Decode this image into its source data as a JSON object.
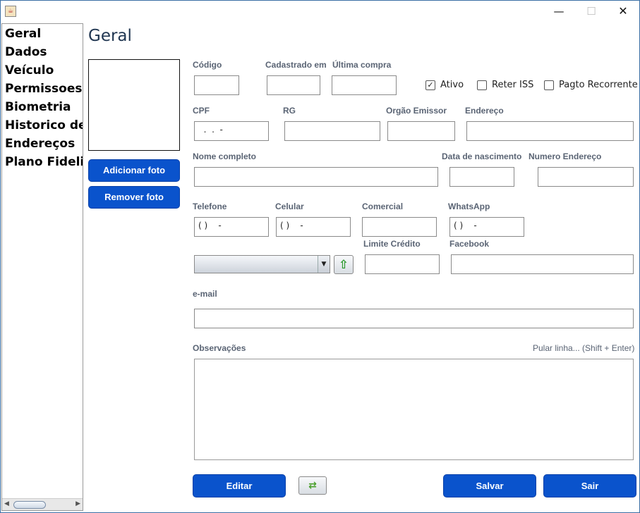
{
  "window": {
    "icon": "java-app-icon",
    "minimize": "—",
    "maximize": "☐",
    "close": "✕"
  },
  "sidebar": {
    "items": [
      "Geral",
      "Dados",
      "Veículo",
      "Permissoes",
      "Biometria",
      "Historico de",
      "Endereços",
      "Plano Fidelic"
    ]
  },
  "page": {
    "title": "Geral"
  },
  "photo": {
    "add_label": "Adicionar foto",
    "remove_label": "Remover foto"
  },
  "labels": {
    "codigo": "Código",
    "cadastrado_em": "Cadastrado em",
    "ultima_compra": "Última compra",
    "cpf": "CPF",
    "rg": "RG",
    "orgao_emissor": "Orgão Emissor",
    "endereco": "Endereço",
    "nome_completo": "Nome completo",
    "data_nascimento": "Data de nascimento",
    "numero_endereco": "Numero Endereço",
    "telefone": "Telefone",
    "celular": "Celular",
    "comercial": "Comercial",
    "whatsapp": "WhatsApp",
    "limite_credito": "Limite Crédito",
    "facebook": "Facebook",
    "email": "e-mail",
    "observacoes": "Observações",
    "pular_linha_hint": "Pular linha... (Shift + Enter)"
  },
  "checkboxes": {
    "ativo": {
      "label": "Ativo",
      "checked": true
    },
    "reter_iss": {
      "label": "Reter ISS",
      "checked": false
    },
    "pagto_recorrente": {
      "label": "Pagto Recorrente",
      "checked": false
    }
  },
  "values": {
    "codigo": "",
    "cadastrado_em": "",
    "ultima_compra": "",
    "cpf": "  .  .  -",
    "rg": "",
    "orgao_emissor": "",
    "endereco": "",
    "nome_completo": "",
    "data_nascimento": "",
    "numero_endereco": "",
    "telefone": "( )    -",
    "celular": "( )    -",
    "comercial": "",
    "whatsapp": "( )    -",
    "combo": "",
    "limite_credito": "",
    "facebook": "",
    "email": "",
    "observacoes": ""
  },
  "buttons": {
    "editar": "Editar",
    "salvar": "Salvar",
    "sair": "Sair"
  },
  "icons": {
    "upload": "up-arrow-icon",
    "refresh": "refresh-icon"
  },
  "colors": {
    "primary_button": "#0a53cc",
    "label": "#5a6474",
    "title": "#1f3550"
  }
}
